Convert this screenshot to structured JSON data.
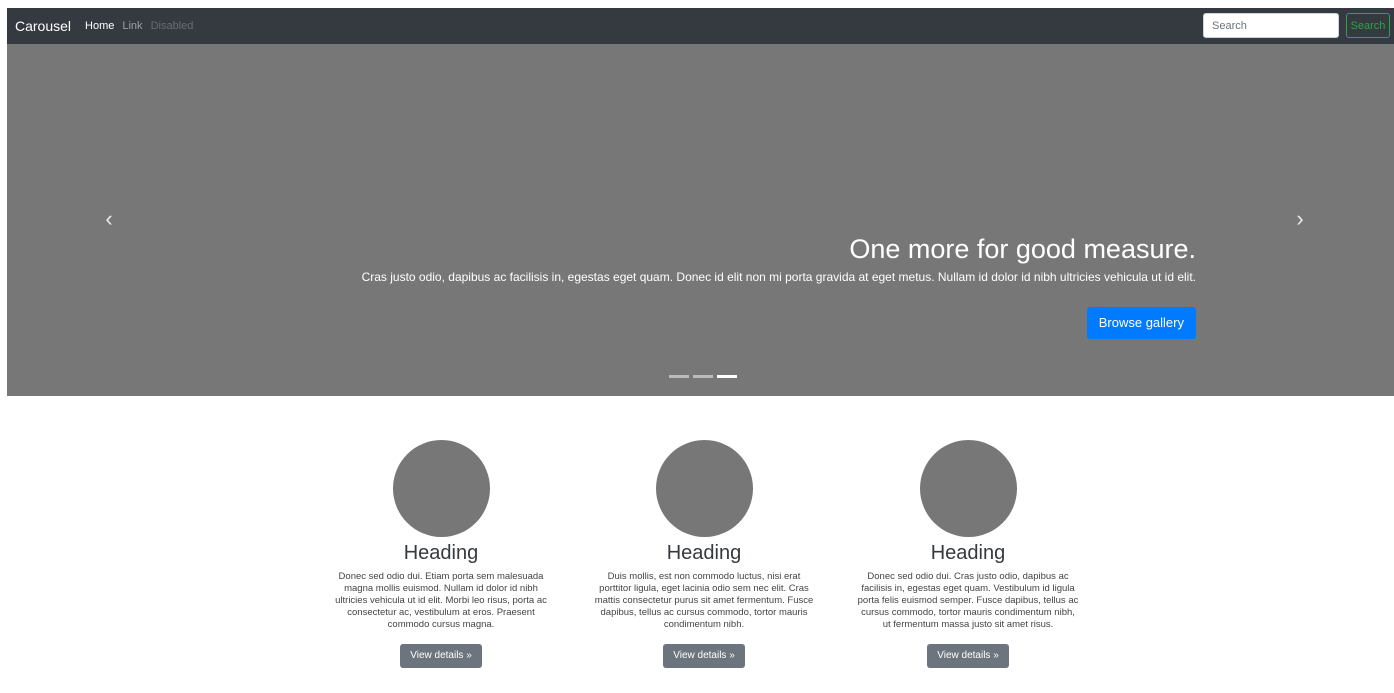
{
  "navbar": {
    "brand": "Carousel",
    "links": [
      {
        "label": "Home"
      },
      {
        "label": "Link"
      },
      {
        "label": "Disabled"
      }
    ],
    "search": {
      "placeholder": "Search",
      "button_label": "Search"
    }
  },
  "carousel": {
    "prev_icon": "‹",
    "next_icon": "›",
    "caption_title": "One more for good measure.",
    "caption_text": "Cras justo odio, dapibus ac facilisis in, egestas eget quam. Donec id elit non mi porta gravida at eget metus. Nullam id dolor id nibh ultricies vehicula ut id elit.",
    "button_label": "Browse gallery",
    "indicators_count": 3,
    "active_indicator": 3
  },
  "columns": [
    {
      "heading": "Heading",
      "text": "Donec sed odio dui. Etiam porta sem malesuada magna mollis euismod. Nullam id dolor id nibh ultricies vehicula ut id elit. Morbi leo risus, porta ac consectetur ac, vestibulum at eros. Praesent commodo cursus magna.",
      "button_label": "View details »"
    },
    {
      "heading": "Heading",
      "text": "Duis mollis, est non commodo luctus, nisi erat porttitor ligula, eget lacinia odio sem nec elit. Cras mattis consectetur purus sit amet fermentum. Fusce dapibus, tellus ac cursus commodo, tortor mauris condimentum nibh.",
      "button_label": "View details »"
    },
    {
      "heading": "Heading",
      "text": "Donec sed odio dui. Cras justo odio, dapibus ac facilisis in, egestas eget quam. Vestibulum id ligula porta felis euismod semper. Fusce dapibus, tellus ac cursus commodo, tortor mauris condimentum nibh, ut fermentum massa justo sit amet risus.",
      "button_label": "View details »"
    }
  ],
  "colors": {
    "navbar_bg": "#343a40",
    "carousel_bg": "#777777",
    "primary": "#007bff",
    "success": "#28a745",
    "secondary": "#6c757d"
  }
}
